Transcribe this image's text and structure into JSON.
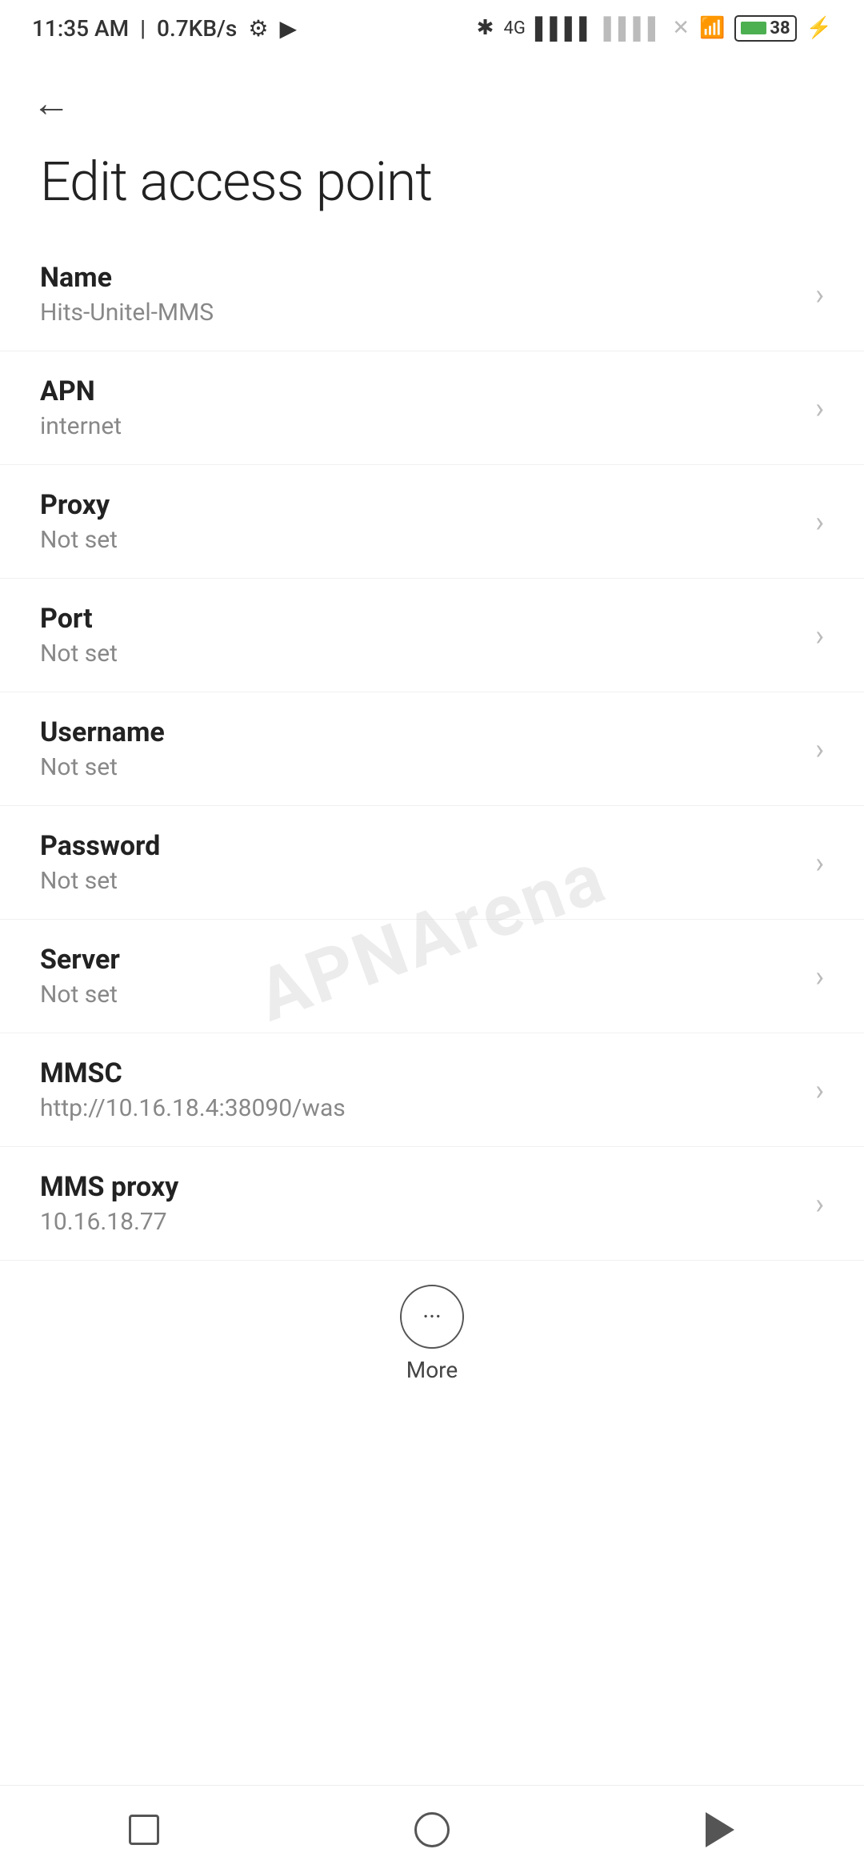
{
  "statusBar": {
    "time": "11:35 AM",
    "speed": "0.7KB/s"
  },
  "page": {
    "title": "Edit access point",
    "backLabel": "←"
  },
  "settings": [
    {
      "id": "name",
      "label": "Name",
      "value": "Hits-Unitel-MMS"
    },
    {
      "id": "apn",
      "label": "APN",
      "value": "internet"
    },
    {
      "id": "proxy",
      "label": "Proxy",
      "value": "Not set"
    },
    {
      "id": "port",
      "label": "Port",
      "value": "Not set"
    },
    {
      "id": "username",
      "label": "Username",
      "value": "Not set"
    },
    {
      "id": "password",
      "label": "Password",
      "value": "Not set"
    },
    {
      "id": "server",
      "label": "Server",
      "value": "Not set"
    },
    {
      "id": "mmsc",
      "label": "MMSC",
      "value": "http://10.16.18.4:38090/was"
    },
    {
      "id": "mms-proxy",
      "label": "MMS proxy",
      "value": "10.16.18.77"
    }
  ],
  "more": {
    "label": "More",
    "icon": "···"
  },
  "watermark": "APNArena"
}
